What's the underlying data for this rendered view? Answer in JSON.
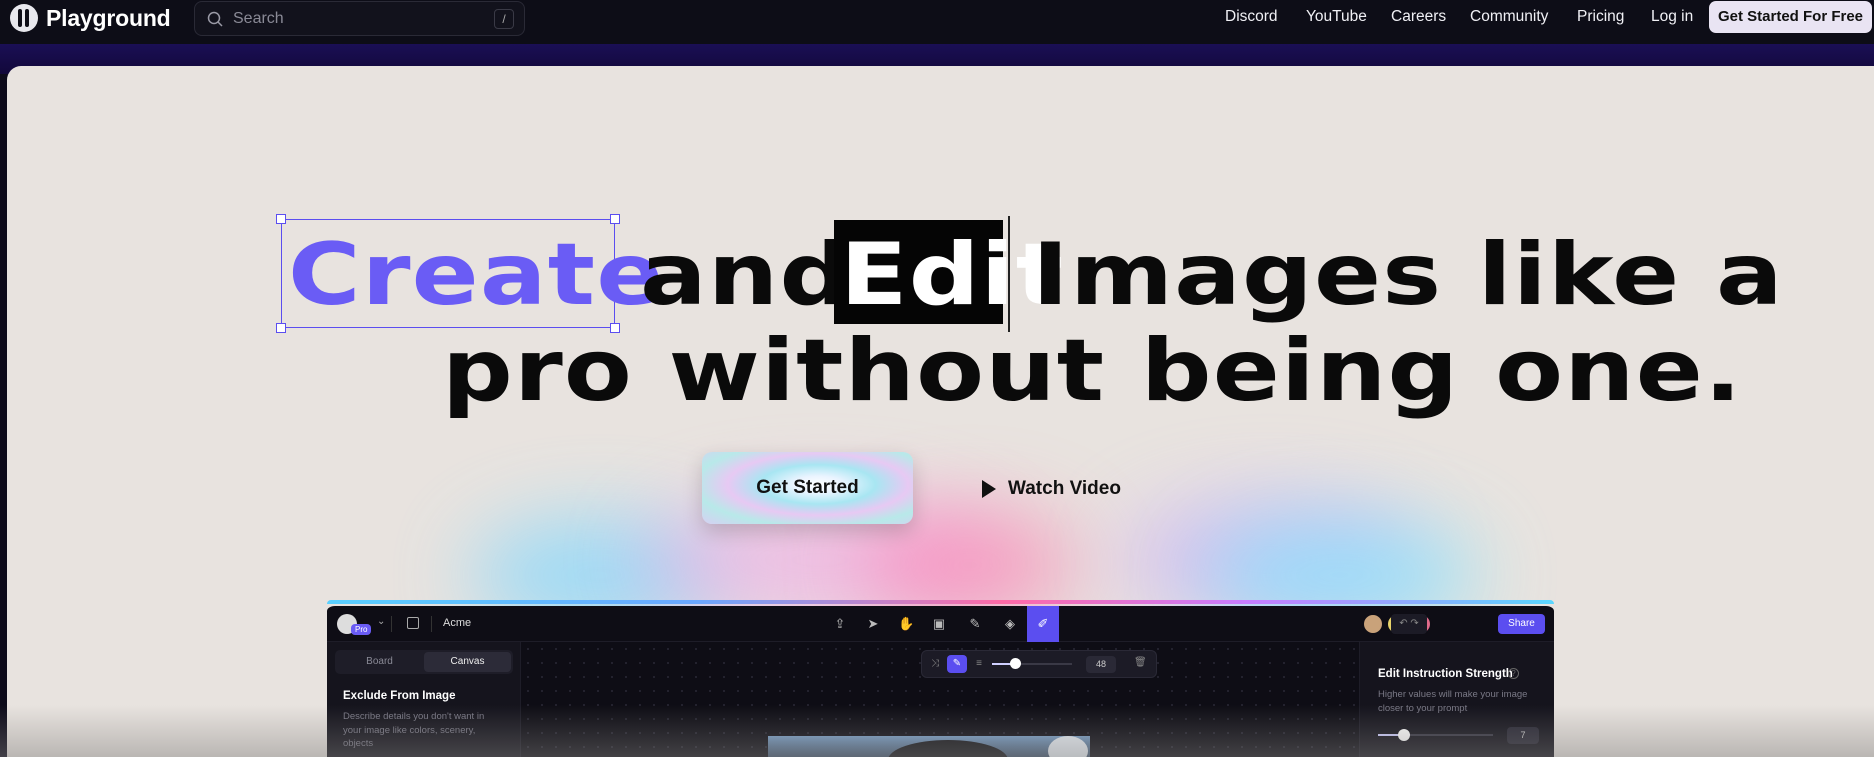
{
  "nav": {
    "brand": "Playground",
    "search_placeholder": "Search",
    "search_shortcut": "/",
    "links": [
      "Discord",
      "YouTube",
      "Careers",
      "Community",
      "Pricing",
      "Log in"
    ],
    "cta": "Get Started For Free"
  },
  "hero": {
    "word_create": "Create",
    "word_and": "and",
    "word_edit": "Edit",
    "word_rest": "Images like a",
    "line2": "pro without being one.",
    "primary_cta": "Get Started",
    "secondary_cta": "Watch Video"
  },
  "app": {
    "badge": "Pro",
    "project_name": "Acme",
    "share": "Share",
    "tabs": [
      "Board",
      "Canvas"
    ],
    "exclude_title": "Exclude From Image",
    "exclude_desc": "Describe details you don't want in your image like colors, scenery, objects",
    "brush_size": "48",
    "strength_title": "Edit Instruction Strength",
    "strength_desc": "Higher values will make your image closer to your prompt",
    "strength_value": "7",
    "brush_size_fraction": 0.28,
    "strength_fraction": 0.2
  },
  "colors": {
    "accent": "#6a5cf5",
    "hero_bg": "#e8e3df",
    "nav_bg": "#0d0d17"
  },
  "icons": [
    "search-icon",
    "play-icon",
    "logo-icon",
    "pen-icon",
    "trash-icon",
    "help-icon"
  ]
}
